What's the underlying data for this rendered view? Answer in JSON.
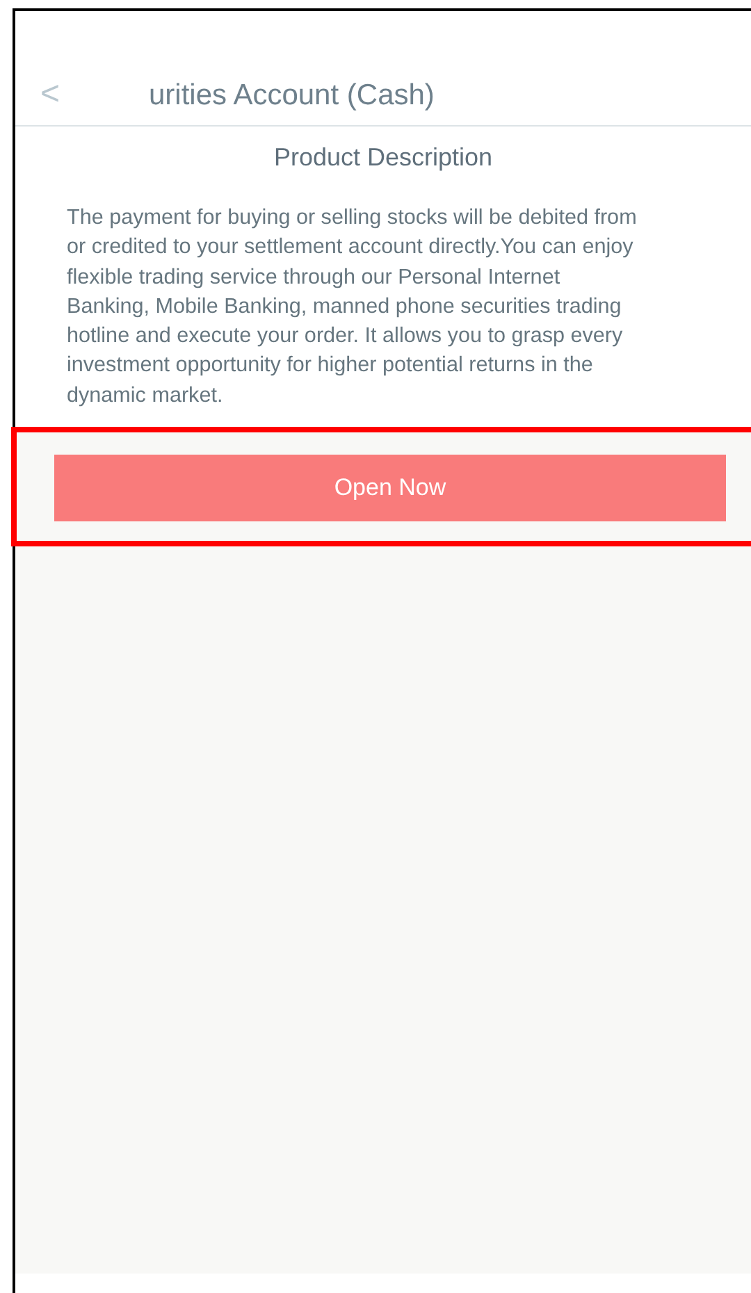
{
  "header": {
    "back_icon": "<",
    "title": "urities Account (Cash)"
  },
  "section": {
    "heading": "Product Description",
    "lines": [
      "The payment for buying or selling stocks will be debited from",
      "or credited to your settlement account directly.You can enjoy",
      "flexible trading service through our Personal Internet",
      "Banking, Mobile Banking, manned phone securities trading",
      "hotline and execute your order. It allows you to grasp every",
      "investment opportunity for higher potential returns in the",
      "dynamic market."
    ]
  },
  "action": {
    "label": "Open Now",
    "highlighted": true
  }
}
